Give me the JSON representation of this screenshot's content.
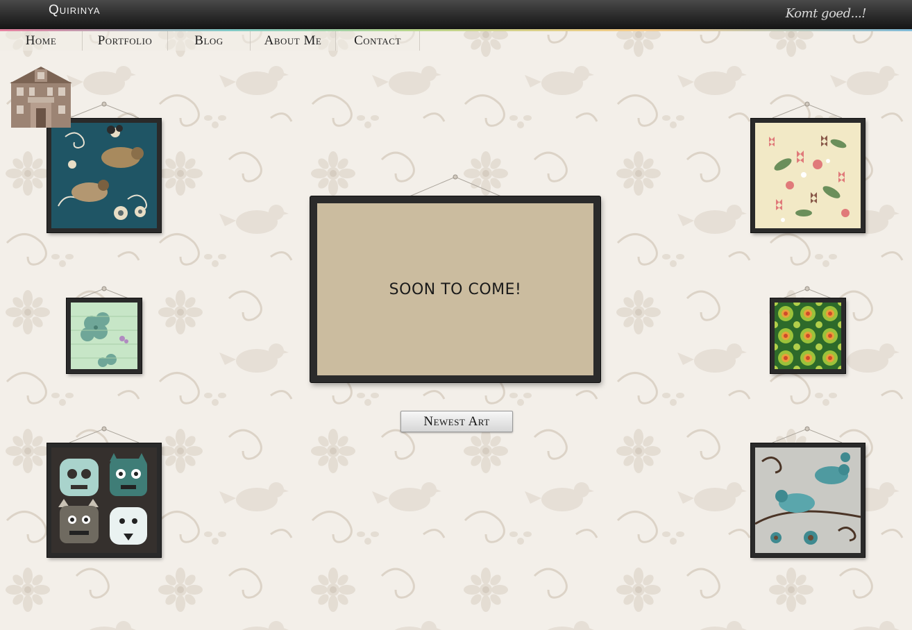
{
  "header": {
    "brand": "Quirinya",
    "tagline": "Komt goed...!"
  },
  "nav": {
    "items": [
      {
        "label": "Home"
      },
      {
        "label": "Portfolio"
      },
      {
        "label": "Blog"
      },
      {
        "label": "About Me"
      },
      {
        "label": "Contact"
      }
    ]
  },
  "icons": {
    "home": "house-icon"
  },
  "featured": {
    "message": "SOON TO COME!",
    "button_label": "Newest Art"
  },
  "gallery": {
    "frames": [
      {
        "name": "teal-birds-pattern"
      },
      {
        "name": "butterflies-blossom-pattern"
      },
      {
        "name": "mint-clover-pattern"
      },
      {
        "name": "green-retro-flower-pattern"
      },
      {
        "name": "monsters-illustration"
      },
      {
        "name": "blue-birds-branches-pattern"
      }
    ]
  },
  "colors": {
    "background": "#f3efe9",
    "frame": "#2a2a2a",
    "canvas": "#cbbc9f"
  }
}
